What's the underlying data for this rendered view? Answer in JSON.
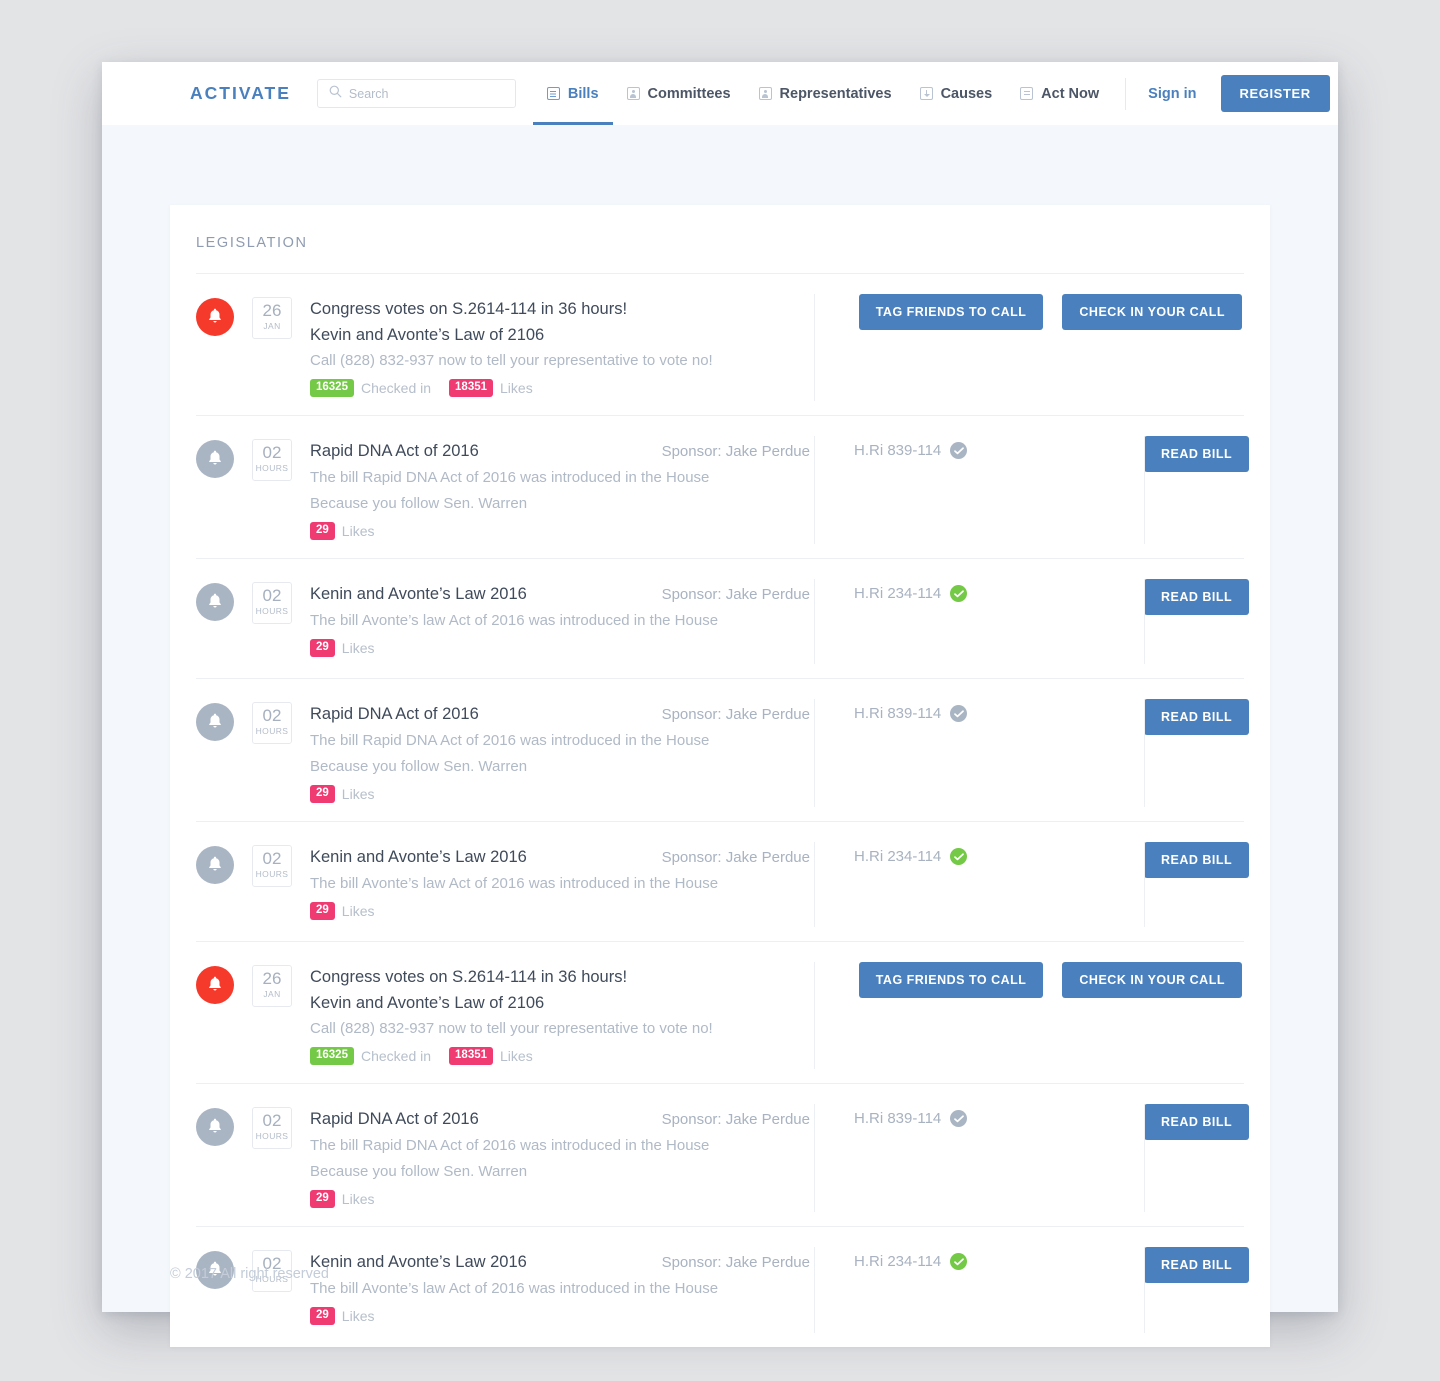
{
  "header": {
    "logo": "ACTIVATE",
    "search": {
      "placeholder": "Search",
      "value": "",
      "icon": "search-icon"
    },
    "nav": [
      {
        "label": "Bills",
        "icon": "document-icon",
        "active": true
      },
      {
        "label": "Committees",
        "icon": "people-icon",
        "active": false
      },
      {
        "label": "Representatives",
        "icon": "person-icon",
        "active": false
      },
      {
        "label": "Causes",
        "icon": "download-icon",
        "active": false
      },
      {
        "label": "Act Now",
        "icon": "doc-lines-icon",
        "active": false
      }
    ],
    "signin_label": "Sign in",
    "register_label": "REGISTER"
  },
  "main": {
    "section_title": "LEGISLATION",
    "rows": [
      {
        "type": "alert",
        "bell": "bell-icon-alert",
        "date_num": "26",
        "date_unit": "JAN",
        "title": "Congress votes on S.2614-114 in 36 hours!",
        "subtitle": "Kevin and Avonte’s Law of 2106",
        "cta": "Call (828) 832-937 now to tell your representative to vote no!",
        "checked_in_count": "16325",
        "checked_in_label": "Checked in",
        "likes_count": "18351",
        "likes_label": "Likes",
        "buttons": [
          "TAG FRIENDS TO CALL",
          "CHECK IN YOUR CALL"
        ]
      },
      {
        "type": "bill",
        "bell": "bell-icon",
        "date_num": "02",
        "date_unit": "HOURS",
        "title": "Rapid DNA Act of 2016",
        "sponsor": "Sponsor: Jake Perdue",
        "desc1": "The bill Rapid DNA Act of 2016 was introduced in the House",
        "desc2": "Because you follow Sen. Warren",
        "likes_count": "29",
        "likes_label": "Likes",
        "bill_code": "H.Ri 839-114",
        "verified": false,
        "button": "READ BILL"
      },
      {
        "type": "bill",
        "bell": "bell-icon",
        "date_num": "02",
        "date_unit": "HOURS",
        "title": "Kenin and Avonte’s Law 2016",
        "sponsor": "Sponsor: Jake Perdue",
        "desc1": "The bill Avonte’s law Act of 2016 was introduced in the House",
        "desc2": "",
        "likes_count": "29",
        "likes_label": "Likes",
        "bill_code": "H.Ri 234-114",
        "verified": true,
        "button": "READ BILL"
      },
      {
        "type": "bill",
        "bell": "bell-icon",
        "date_num": "02",
        "date_unit": "HOURS",
        "title": "Rapid DNA Act of 2016",
        "sponsor": "Sponsor: Jake Perdue",
        "desc1": "The bill Rapid DNA Act of 2016 was introduced in the House",
        "desc2": "Because you follow Sen. Warren",
        "likes_count": "29",
        "likes_label": "Likes",
        "bill_code": "H.Ri 839-114",
        "verified": false,
        "button": "READ BILL"
      },
      {
        "type": "bill",
        "bell": "bell-icon",
        "date_num": "02",
        "date_unit": "HOURS",
        "title": "Kenin and Avonte’s Law 2016",
        "sponsor": "Sponsor: Jake Perdue",
        "desc1": "The bill Avonte’s law Act of 2016 was introduced in the House",
        "desc2": "",
        "likes_count": "29",
        "likes_label": "Likes",
        "bill_code": "H.Ri 234-114",
        "verified": true,
        "button": "READ BILL"
      },
      {
        "type": "alert",
        "bell": "bell-icon-alert",
        "date_num": "26",
        "date_unit": "JAN",
        "title": "Congress votes on S.2614-114 in 36 hours!",
        "subtitle": "Kevin and Avonte’s Law of 2106",
        "cta": "Call (828) 832-937 now to tell your representative to vote no!",
        "checked_in_count": "16325",
        "checked_in_label": "Checked in",
        "likes_count": "18351",
        "likes_label": "Likes",
        "buttons": [
          "TAG FRIENDS TO CALL",
          "CHECK IN YOUR CALL"
        ]
      },
      {
        "type": "bill",
        "bell": "bell-icon",
        "date_num": "02",
        "date_unit": "HOURS",
        "title": "Rapid DNA Act of 2016",
        "sponsor": "Sponsor: Jake Perdue",
        "desc1": "The bill Rapid DNA Act of 2016 was introduced in the House",
        "desc2": "Because you follow Sen. Warren",
        "likes_count": "29",
        "likes_label": "Likes",
        "bill_code": "H.Ri 839-114",
        "verified": false,
        "button": "READ BILL"
      },
      {
        "type": "bill",
        "bell": "bell-icon",
        "date_num": "02",
        "date_unit": "HOURS",
        "title": "Kenin and Avonte’s Law 2016",
        "sponsor": "Sponsor: Jake Perdue",
        "desc1": "The bill Avonte’s law Act of 2016 was introduced in the House",
        "desc2": "",
        "likes_count": "29",
        "likes_label": "Likes",
        "bill_code": "H.Ri 234-114",
        "verified": true,
        "button": "READ BILL"
      }
    ]
  },
  "footer": {
    "copyright": "© 2017 All right reserved"
  },
  "colors": {
    "brand": "#4a80bd",
    "alert": "#f5392b",
    "green": "#74c947",
    "pink": "#ef3a72",
    "muted": "#aab5c4"
  }
}
